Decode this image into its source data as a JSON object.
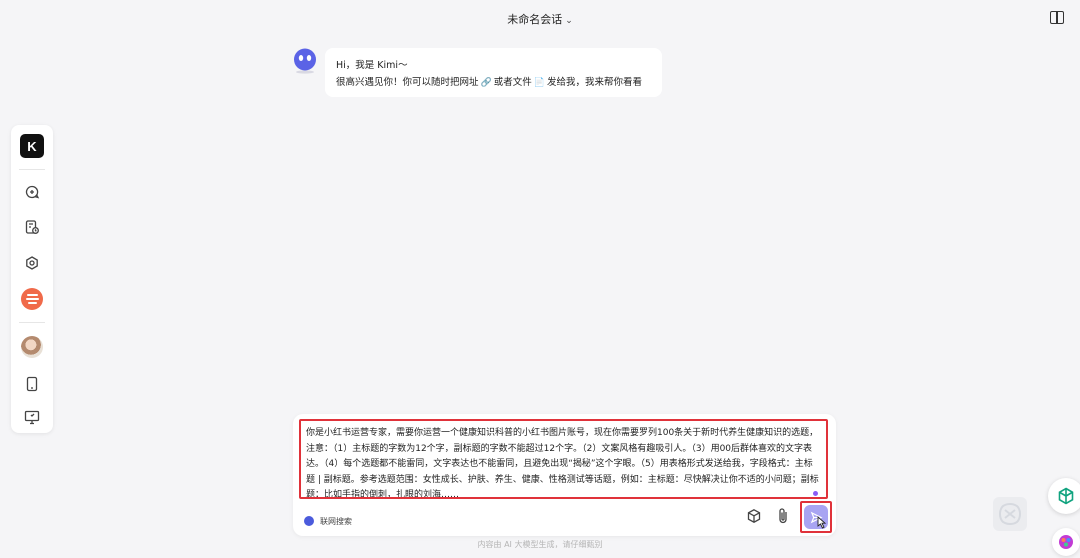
{
  "header": {
    "conversation_title": "未命名会话",
    "dropdown_icon": "chevron-down-icon",
    "layout_icon": "split-panel-icon"
  },
  "sidebar": {
    "logo_letter": "K",
    "items": [
      {
        "icon": "new-chat-icon"
      },
      {
        "icon": "history-icon"
      },
      {
        "icon": "explore-icon"
      },
      {
        "icon": "kimi-plus-icon"
      },
      {
        "icon": "user-avatar"
      },
      {
        "icon": "mobile-app-icon"
      },
      {
        "icon": "desktop-app-icon"
      }
    ]
  },
  "messages": [
    {
      "role": "assistant",
      "line1": "Hi，我是 Kimi～",
      "line2_a": "很高兴遇见你！你可以随时把网址",
      "line2_b": "或者文件",
      "line2_c": "发给我，我来帮你看看"
    }
  ],
  "composer": {
    "prompt_text": "你是小红书运营专家，需要你运营一个健康知识科普的小红书图片账号，现在你需要罗列100条关于新时代养生健康知识的选题，注意：（1）主标题的字数为12个字，副标题的字数不能超过12个字。（2）文案风格有趣吸引人。（3）用00后群体喜欢的文字表达。（4）每个选题都不能雷同，文字表达也不能雷同，且避免出现“揭秘”这个字眼。（5）用表格形式发送给我，字段格式：主标题 | 副标题。参考选题范围：女性成长、护肤、养生、健康、性格测试等话题，例如：主标题：尽快解决让你不适的小问题；副标题：比如手指的倒刺，扎眼的刘海……",
    "web_search_label": "联网搜索",
    "web_search_enabled": true
  },
  "footer": {
    "disclaimer": "内容由 AI 大模型生成，请仔细甄别"
  },
  "colors": {
    "accent_red": "#e0323a",
    "send_button": "#a8a4f2",
    "toggle_blue": "#4b5bdc"
  }
}
